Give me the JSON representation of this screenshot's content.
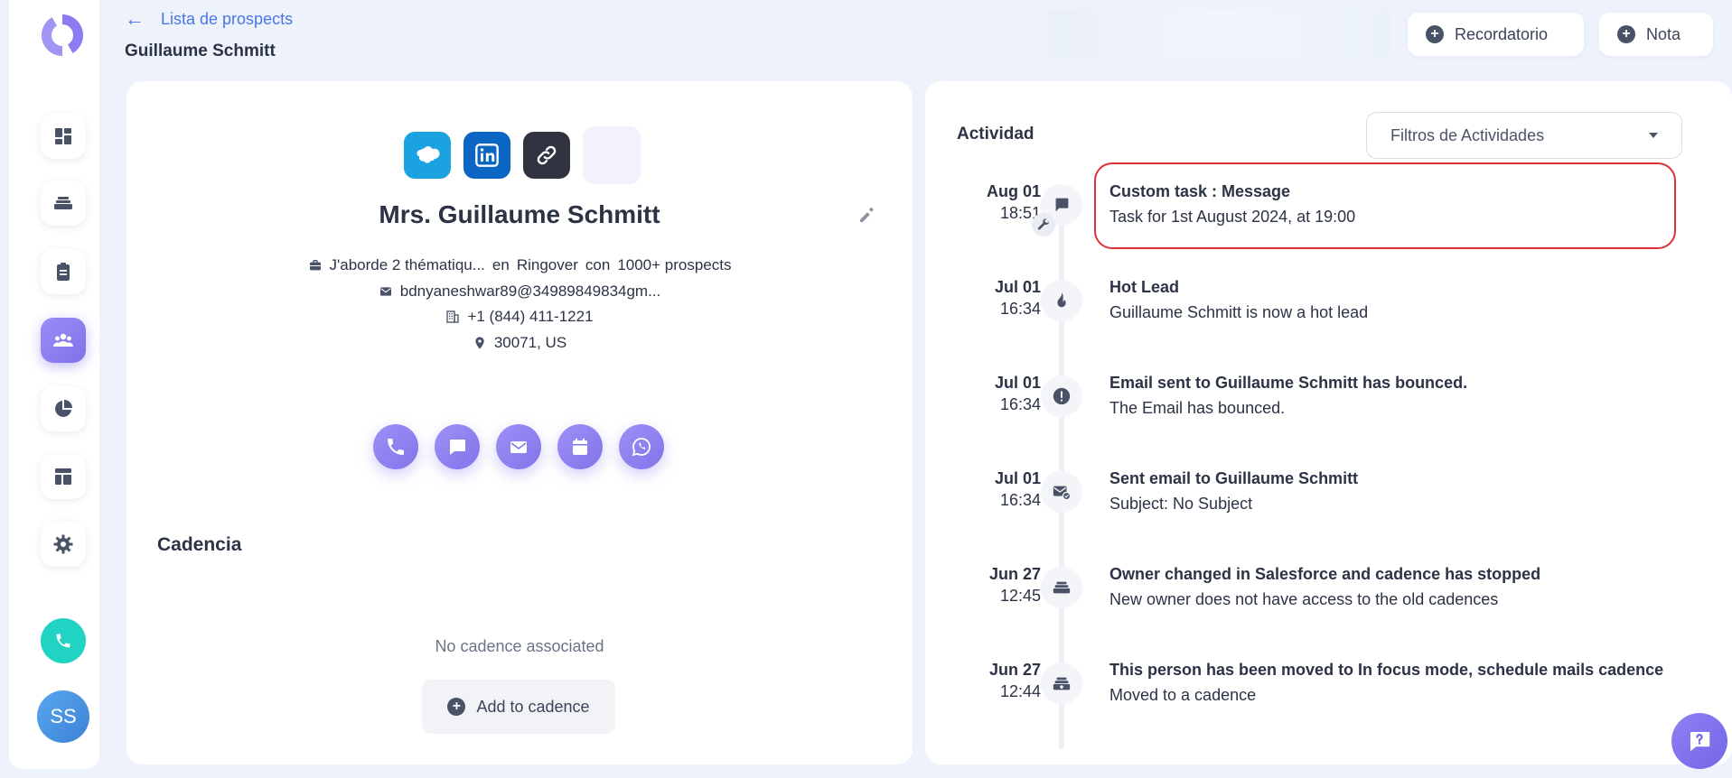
{
  "header": {
    "back_label": "Lista de prospects",
    "title": "Guillaume Schmitt",
    "reminder_button": "Recordatorio",
    "note_button": "Nota"
  },
  "sidebar": {
    "items": [
      {
        "icon": "dashboard-icon",
        "active": false
      },
      {
        "icon": "cadence-stack-icon",
        "active": false
      },
      {
        "icon": "tasks-clipboard-icon",
        "active": false
      },
      {
        "icon": "people-icon",
        "active": true
      },
      {
        "icon": "pie-chart-icon",
        "active": false
      },
      {
        "icon": "templates-layout-icon",
        "active": false
      },
      {
        "icon": "settings-gear-icon",
        "active": false
      }
    ],
    "avatar_initials": "SS"
  },
  "prospect": {
    "name": "Mrs. Guillaume Schmitt",
    "job": "J'aborde 2 thématiqu...",
    "job_connector_1": "en",
    "company": "Ringover",
    "job_connector_2": "con",
    "prospects_count": "1000+ prospects",
    "email": "bdnyaneshwar89@34989849834gm...",
    "phone": "+1 (844) 411-1221",
    "location": "30071, US"
  },
  "cadence": {
    "section_title": "Cadencia",
    "empty_text": "No cadence associated",
    "add_button": "Add to cadence"
  },
  "activity": {
    "title": "Actividad",
    "filter_placeholder": "Filtros de Actividades",
    "entries": [
      {
        "date": "Aug 01",
        "time": "18:51",
        "title": "Custom task : Message",
        "subtitle": "Task for 1st August 2024, at 19:00",
        "icon": "message-icon",
        "highlighted": true
      },
      {
        "date": "Jul 01",
        "time": "16:34",
        "title": "Hot Lead",
        "subtitle": "Guillaume Schmitt is now a hot lead",
        "icon": "flame-icon",
        "highlighted": false
      },
      {
        "date": "Jul 01",
        "time": "16:34",
        "title": "Email sent to Guillaume Schmitt has bounced.",
        "subtitle": "The Email has bounced.",
        "icon": "alert-icon",
        "highlighted": false
      },
      {
        "date": "Jul 01",
        "time": "16:34",
        "title": "Sent email to Guillaume Schmitt",
        "subtitle": "Subject: No Subject",
        "icon": "mail-sent-icon",
        "highlighted": false
      },
      {
        "date": "Jun 27",
        "time": "12:45",
        "title": "Owner changed in Salesforce and cadence has stopped",
        "subtitle": "New owner does not have access to the old cadences",
        "icon": "cadence-stack-icon",
        "highlighted": false
      },
      {
        "date": "Jun 27",
        "time": "12:44",
        "title": "This person has been moved to In focus mode, schedule mails cadence",
        "subtitle": "Moved to a cadence",
        "icon": "cadence-add-icon",
        "highlighted": false
      }
    ]
  },
  "colors": {
    "accent": "#8175ea",
    "link": "#4a74e8",
    "call": "#21d3c3",
    "highlight_border": "#e0303a"
  }
}
